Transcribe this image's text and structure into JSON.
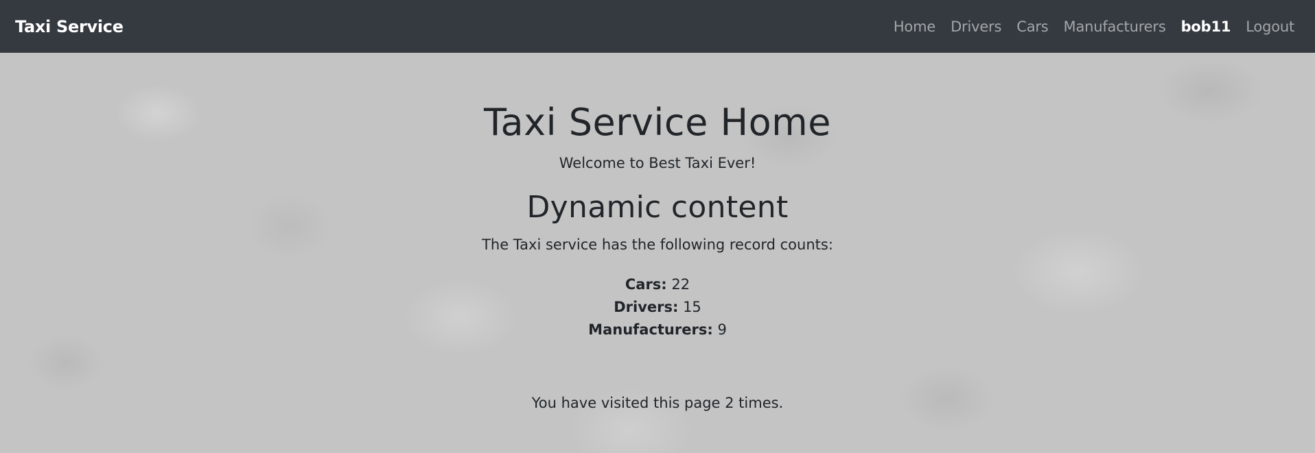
{
  "navbar": {
    "brand": "Taxi Service",
    "links": [
      {
        "label": "Home"
      },
      {
        "label": "Drivers"
      },
      {
        "label": "Cars"
      },
      {
        "label": "Manufacturers"
      }
    ],
    "user": "bob11",
    "logout": "Logout"
  },
  "main": {
    "title": "Taxi Service Home",
    "subtitle": "Welcome to Best Taxi Ever!",
    "section_title": "Dynamic content",
    "intro": "The Taxi service has the following record counts:",
    "counts": [
      {
        "label": "Cars:",
        "value": "22"
      },
      {
        "label": "Drivers:",
        "value": "15"
      },
      {
        "label": "Manufacturers:",
        "value": "9"
      }
    ],
    "visits": "You have visited this page 2 times."
  },
  "colors": {
    "navbar_bg": "#343a40",
    "text": "#212529",
    "nav_link": "rgba(255,255,255,0.55)",
    "page_bg": "#c4c4c4"
  }
}
